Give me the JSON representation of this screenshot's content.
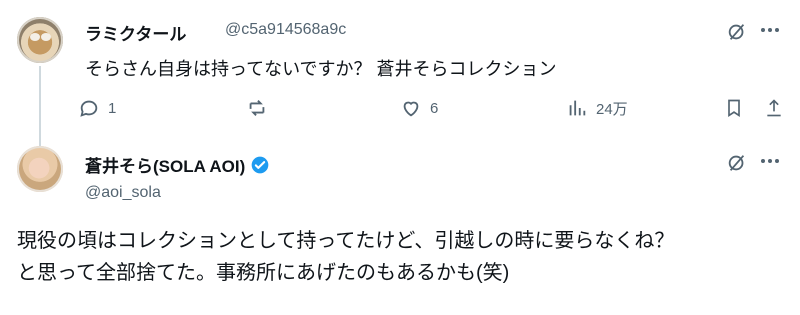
{
  "reply_tweet": {
    "display_name": "ラミクタール",
    "handle": "@c5a914568a9c",
    "text": "そらさん自身は持ってないですか？ 蒼井そらコレクション",
    "actions": {
      "replies": "1",
      "reposts": "",
      "likes": "6",
      "views": "24万"
    },
    "icons": [
      "grok-icon",
      "more-icon",
      "reply-icon",
      "repost-icon",
      "like-icon",
      "views-icon",
      "bookmark-icon",
      "share-icon"
    ]
  },
  "main_tweet": {
    "display_name": "蒼井そら(SOLA AOI)",
    "handle": "@aoi_sola",
    "verified_color": "#1d9bf0",
    "text_lines": [
      "現役の頃はコレクションとして持ってたけど、引越しの時に要らなくね？",
      "と思って全部捨てた。事務所にあげたのもあるかも(笑)"
    ],
    "icons": [
      "grok-icon",
      "more-icon",
      "verified-badge-icon"
    ]
  },
  "colors": {
    "text_primary": "#0f1419",
    "text_secondary": "#536471",
    "thread_line": "#cfd9de"
  }
}
